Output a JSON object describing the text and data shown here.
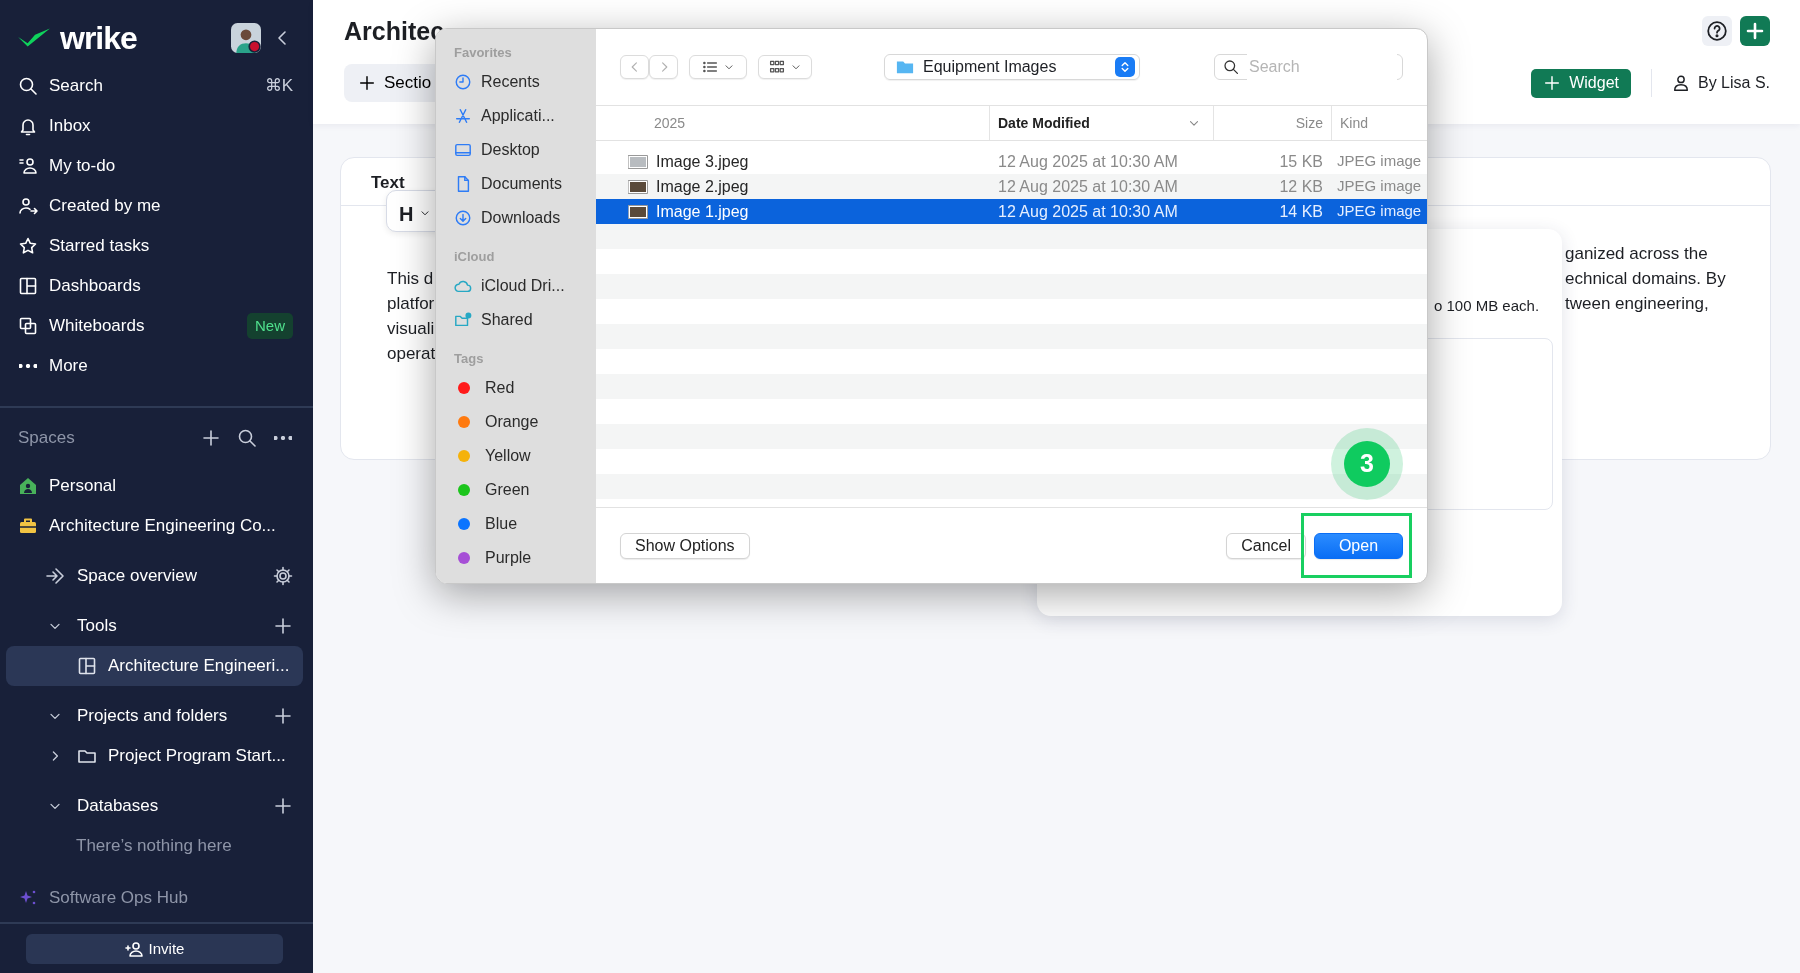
{
  "sidebar": {
    "logo": "wrike",
    "nav": [
      {
        "label": "Search",
        "shortcut": "⌘K",
        "selected": false
      },
      {
        "label": "Inbox",
        "selected": false
      },
      {
        "label": "My to-do",
        "selected": false
      },
      {
        "label": "Created by me",
        "selected": false
      },
      {
        "label": "Starred tasks",
        "selected": false
      },
      {
        "label": "Dashboards",
        "selected": false
      },
      {
        "label": "Whiteboards",
        "badge": "New",
        "selected": false
      },
      {
        "label": "More",
        "selected": false
      }
    ],
    "spaces_title": "Spaces",
    "spaces": [
      {
        "label": "Personal",
        "dimmed": false,
        "selected": false
      },
      {
        "label": "Architecture Engineering Co...",
        "dimmed": false,
        "selected": false,
        "children": [
          {
            "kind": "link",
            "label": "Space overview",
            "selected": false
          },
          {
            "kind": "section",
            "label": "Tools",
            "expanded": true,
            "selected": false,
            "children": [
              {
                "kind": "item",
                "label": "Architecture Engineeri...",
                "selected": true
              }
            ]
          },
          {
            "kind": "section",
            "label": "Projects and folders",
            "expanded": true,
            "selected": false,
            "children": [
              {
                "kind": "folder",
                "label": "Project Program Start...",
                "expanded": false,
                "selected": false
              }
            ]
          },
          {
            "kind": "section",
            "label": "Databases",
            "expanded": true,
            "selected": false,
            "children": [
              {
                "kind": "note",
                "label": "There’s nothing here"
              }
            ]
          }
        ]
      },
      {
        "label": "Software Ops Hub",
        "dimmed": true,
        "selected": false
      }
    ],
    "invite": "Invite"
  },
  "page": {
    "title": "Architec",
    "section_button": "Sectio",
    "widget_button": "Widget",
    "author": "By Lisa S.",
    "card": {
      "tab": "Text",
      "heading_dropdown": "H",
      "left_lines": [
        "This d",
        "platfor",
        "visuali",
        "operat"
      ],
      "right_lines": [
        "ganized across the",
        "echnical domains. By",
        "tween engineering,"
      ]
    },
    "popover": {
      "note": "o 100 MB each."
    }
  },
  "file_dialog": {
    "sidebar_sections": [
      {
        "title": "Favorites",
        "items": [
          {
            "label": "Recents"
          },
          {
            "label": "Applicati..."
          },
          {
            "label": "Desktop"
          },
          {
            "label": "Documents"
          },
          {
            "label": "Downloads"
          }
        ]
      },
      {
        "title": "iCloud",
        "items": [
          {
            "label": "iCloud Dri..."
          },
          {
            "label": "Shared"
          }
        ]
      },
      {
        "title": "Tags",
        "items": [
          {
            "label": "Red",
            "color": "#ff1a1a"
          },
          {
            "label": "Orange",
            "color": "#ff7a0f"
          },
          {
            "label": "Yellow",
            "color": "#f5b20a"
          },
          {
            "label": "Green",
            "color": "#1cc51c"
          },
          {
            "label": "Blue",
            "color": "#0a74ff"
          },
          {
            "label": "Purple",
            "color": "#a64fd6"
          }
        ]
      }
    ],
    "location": "Equipment Images",
    "search": {
      "placeholder": "Search"
    },
    "columns": [
      {
        "label": "2025",
        "sorted": false
      },
      {
        "label": "Date Modified",
        "sorted": true
      },
      {
        "label": "Size",
        "sorted": false
      },
      {
        "label": "Kind",
        "sorted": false
      }
    ],
    "files": [
      {
        "name": "Image 3.jpeg",
        "modified": "12 Aug 2025 at 10:30 AM",
        "size": "15 KB",
        "type": "JPEG image",
        "selected": false
      },
      {
        "name": "Image 2.jpeg",
        "modified": "12 Aug 2025 at 10:30 AM",
        "size": "12 KB",
        "type": "JPEG image",
        "selected": false
      },
      {
        "name": "Image 1.jpeg",
        "modified": "12 Aug 2025 at 10:30 AM",
        "size": "14 KB",
        "type": "JPEG image",
        "selected": true
      }
    ],
    "buttons": [
      {
        "label": "Show Options",
        "primary": false
      },
      {
        "label": "Cancel",
        "primary": false
      },
      {
        "label": "Open",
        "primary": true
      }
    ]
  },
  "step_marker": {
    "number": "3"
  }
}
